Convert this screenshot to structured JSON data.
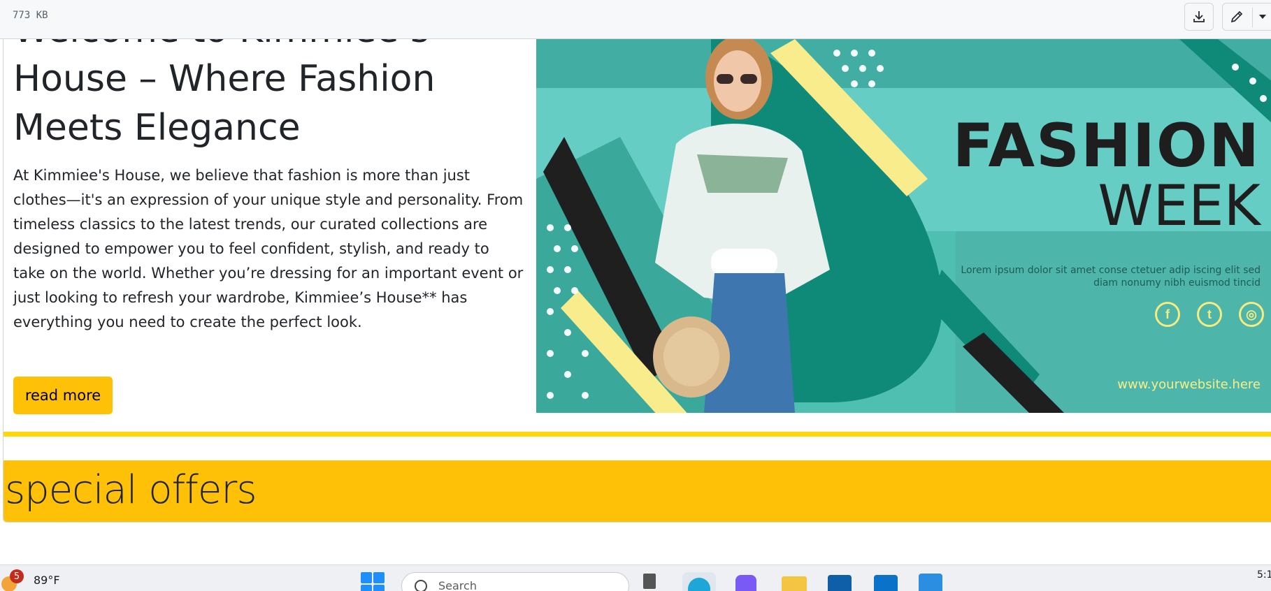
{
  "viewer": {
    "file_size": "773 KB",
    "download_icon": "download-icon",
    "edit_icon": "pencil-icon",
    "more_icon": "chevron-down-icon"
  },
  "hero": {
    "title": "Welcome to Kimmiee’s House – Where Fashion Meets Elegance",
    "body": "At Kimmiee's House, we believe that fashion is more than just clothes—it's an expression of your unique style and personality. From timeless classics to the latest trends, our curated collections are designed to empower you to feel confident, stylish, and ready to take on the world. Whether you’re dressing for an important event or just looking to refresh your wardrobe, Kimmiee’s House** has everything you need to create the perfect look.",
    "button_label": "read more",
    "button_color": "#ffc107"
  },
  "banner": {
    "line1": "FASHION",
    "line2": "WEEK",
    "lorem": "Lorem ipsum dolor sit amet conse ctetuer adip iscing elit sed diam nonumy nibh euismod tincid",
    "url": "www.yourwebsite.here",
    "social": [
      "f",
      "t",
      "ig"
    ],
    "colors": {
      "teal": "#43b3a7",
      "dark_teal": "#0f8a78",
      "yellow": "#f8ec8c",
      "black": "#1e1e1e"
    }
  },
  "offers": {
    "title": "special offers",
    "band_color": "#ffc107",
    "line_color": "#ffd60a"
  },
  "taskbar": {
    "weather_badge": "5",
    "temperature": "89°F",
    "search_placeholder": "Search",
    "time": "5:1"
  }
}
